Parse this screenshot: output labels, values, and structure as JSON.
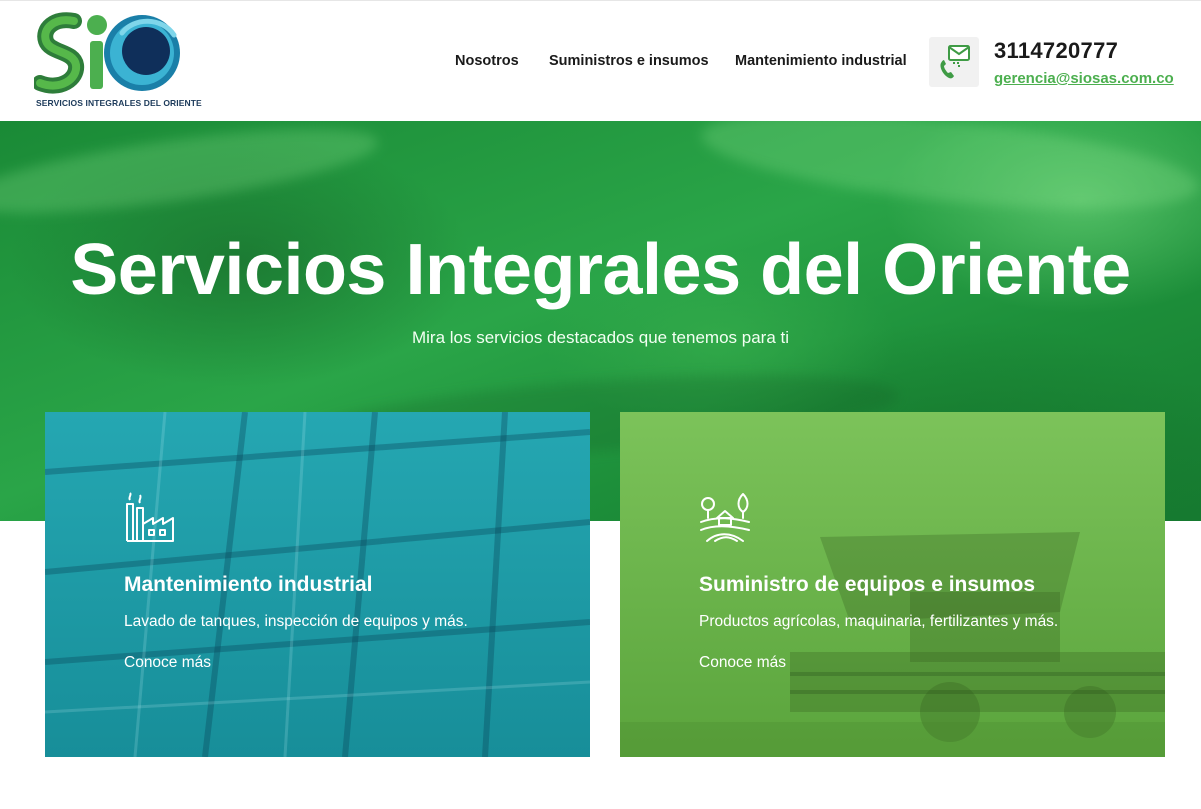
{
  "header": {
    "logo_caption": "SERVICIOS INTEGRALES DEL ORIENTE",
    "nav": [
      {
        "label": "Nosotros"
      },
      {
        "label": "Suministros e insumos"
      },
      {
        "label": "Mantenimiento industrial"
      }
    ],
    "contact": {
      "phone": "3114720777",
      "email": "gerencia@siosas.com.co",
      "icon": "phone-mail-icon"
    }
  },
  "hero": {
    "title": "Servicios Integrales del Oriente",
    "subtitle": "Mira los servicios destacados que tenemos para ti"
  },
  "cards": [
    {
      "icon": "factory-icon",
      "title": "Mantenimiento industrial",
      "description": "Lavado de tanques, inspección de equipos y más.",
      "link": "Conoce más"
    },
    {
      "icon": "farm-icon",
      "title": "Suministro de equipos e insumos",
      "description": "Productos agrícolas, maquinaria, fertilizantes y más.",
      "link": "Conoce más"
    }
  ],
  "colors": {
    "brand_green": "#4caf4f",
    "hero_green": "#1f9a3f",
    "card_teal": "#1e9ca7",
    "card_green": "#6bb54b",
    "logo_blue": "#1c3a5a"
  }
}
